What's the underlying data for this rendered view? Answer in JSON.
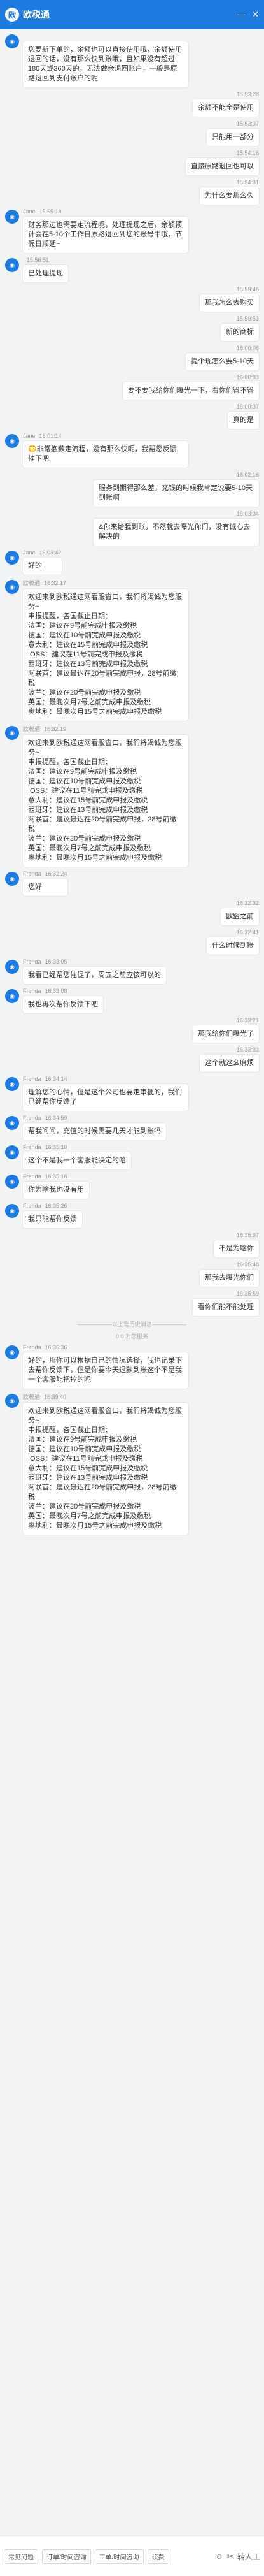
{
  "header": {
    "title": "欧税通",
    "logo": "欧"
  },
  "messages": [
    {
      "side": "left",
      "sender": "",
      "time": "",
      "text": "您要新下单的，余额也可以直接使用哦，余额使用退回的话，没有那么快到账哦，且如果没有超过180天或360天的，无法做余退回账户，一般是原路退回到支付账户的呢"
    },
    {
      "side": "right",
      "time": "15:53:28",
      "text": "余额不能全是使用"
    },
    {
      "side": "right",
      "time": "15:53:37",
      "text": "只能用一部分"
    },
    {
      "side": "right",
      "time": "15:54:16",
      "text": "直接原路退回也可以"
    },
    {
      "side": "right",
      "time": "15:54:31",
      "text": "为什么要那么久"
    },
    {
      "side": "left",
      "sender": "Jane",
      "time": "15:55:18",
      "text": "财务那边也需要走流程呢，处理提现之后，余额预计会在5-10个工作日原路退回到您的账号中哦，节假日顺延~"
    },
    {
      "side": "left",
      "sender": "",
      "time": "15:56:51",
      "text": "已处理提现"
    },
    {
      "side": "right",
      "time": "15:59:46",
      "text": "那我怎么去购买"
    },
    {
      "side": "right",
      "time": "15:59:53",
      "text": "新的商标"
    },
    {
      "side": "right",
      "time": "16:00:08",
      "text": "提个现怎么要5-10天"
    },
    {
      "side": "right",
      "time": "16:00:33",
      "text": "要不要我给你们曝光一下，看你们管不管"
    },
    {
      "side": "right",
      "time": "16:00:37",
      "text": "真的是"
    },
    {
      "side": "left",
      "sender": "Jane",
      "time": "16:01:14",
      "text": "😳非常抱歉走流程，没有那么快呢，我帮您反馈催下吧"
    },
    {
      "side": "right",
      "time": "16:02:16",
      "text": "服务到期得那么差，充钱的时候我肯定说要5-10天到账啊"
    },
    {
      "side": "right",
      "time": "16:03:34",
      "text": "&你来给我到账，不然就去曝光你们，没有诚心去解决的"
    },
    {
      "side": "left",
      "sender": "Jane",
      "time": "16:03:42",
      "text": "好的"
    },
    {
      "side": "left",
      "sender": "欧税通",
      "time": "16:32:17",
      "text": "欢迎来到欧税通速网看服窗口，我们将竭诚为您服务~\n申报提醒，各国截止日期：\n法国：建议在9号前完成申报及缴税\n德国：建议在10号前完成申报及缴税\n意大利：建议在15号前完成申报及缴税\nIOSS：建议在11号前完成申报及缴税\n西班牙：建议在13号前完成申报及缴税\n阿联酋：建议最迟在20号前完成申报，28号前缴税\n波兰：建议在20号前完成申报及缴税\n英国：最晚次月7号之前完成申报及缴税\n奥地利：最晚次月15号之前完成申报及缴税"
    },
    {
      "side": "left",
      "sender": "欧税通",
      "time": "16:32:19",
      "text": "欢迎来到欧税通速网看服窗口，我们将竭诚为您服务~\n申报提醒，各国截止日期：\n法国：建议在9号前完成申报及缴税\n德国：建议在10号前完成申报及缴税\nIOSS：建议在11号前完成申报及缴税\n意大利：建议在15号前完成申报及缴税\n西班牙：建议在13号前完成申报及缴税\n阿联酋：建议最迟在20号前完成申报，28号前缴税\n波兰：建议在20号前完成申报及缴税\n英国：最晚次月7号之前完成申报及缴税\n奥地利：最晚次月15号之前完成申报及缴税"
    },
    {
      "side": "left",
      "sender": "Frenda",
      "time": "16:32:24",
      "text": "您好"
    },
    {
      "side": "right",
      "time": "16:32:32",
      "text": "欧盟之前"
    },
    {
      "side": "right",
      "time": "16:32:41",
      "text": "什么时候到账"
    },
    {
      "side": "left",
      "sender": "Frenda",
      "time": "16:33:05",
      "text": "我看已经帮您催促了，周五之前应该可以的"
    },
    {
      "side": "left",
      "sender": "Frenda",
      "time": "16:33:08",
      "text": "我也再次帮你反馈下吧"
    },
    {
      "side": "right",
      "time": "16:33:21",
      "text": "那我给你们曝光了"
    },
    {
      "side": "right",
      "time": "16:33:33",
      "text": "这个就这么麻烦"
    },
    {
      "side": "left",
      "sender": "Frenda",
      "time": "16:34:14",
      "text": "理解您的心情，但是这个公司也要走审批的，我们已经帮你反馈了"
    },
    {
      "side": "left",
      "sender": "Frenda",
      "time": "16:34:59",
      "text": "帮我问问，充值的时候需要几天才能到账吗"
    },
    {
      "side": "left",
      "sender": "Frenda",
      "time": "16:35:10",
      "text": "这个不是我一个客服能决定的哈"
    },
    {
      "side": "left",
      "sender": "Frenda",
      "time": "16:35:16",
      "text": "你为啥我也没有用"
    },
    {
      "side": "left",
      "sender": "Frenda",
      "time": "16:35:26",
      "text": "我只能帮你反馈"
    },
    {
      "side": "right",
      "time": "16:35:37",
      "text": "不是为啥你"
    },
    {
      "side": "right",
      "time": "16:35:48",
      "text": "那我去曝光你们"
    },
    {
      "side": "right",
      "time": "16:35:59",
      "text": "看你们能不能处理"
    },
    {
      "side": "left",
      "sender": "Frenda",
      "time": "16:36:36",
      "text": "好的，那你可以根据自己的情况选择，我也记录下去帮你反馈下，但是你要今天退款到账这个不是我一个客服能把控的呢"
    },
    {
      "side": "left",
      "sender": "欧税通",
      "time": "16:39:40",
      "text": "欢迎来到欧税通速网看服窗口，我们将竭诚为您服务~\n申报提醒，各国截止日期：\n法国：建议在9号前完成申报及缴税\n德国：建议在10号前完成申报及缴税\nIOSS：建议在11号前完成申报及缴税\n意大利：建议在15号前完成申报及缴税\n西班牙：建议在13号前完成申报及缴税\n阿联酋：建议最迟在20号前完成申报，28号前缴税\n波兰：建议在20号前完成申报及缴税\n英国：最晚次月7号之前完成申报及缴税\n奥地利：最晚次月15号之前完成申报及缴税"
    }
  ],
  "sysnotes": {
    "after": 33,
    "line1": "——————以上是历史消息——————",
    "line2": "0 0 为您服务"
  },
  "bottom": {
    "q1": "常见问题",
    "q2": "订单/时间咨询",
    "q3": "工单/时间咨询",
    "q4": "续费",
    "transfer": "转人工"
  }
}
